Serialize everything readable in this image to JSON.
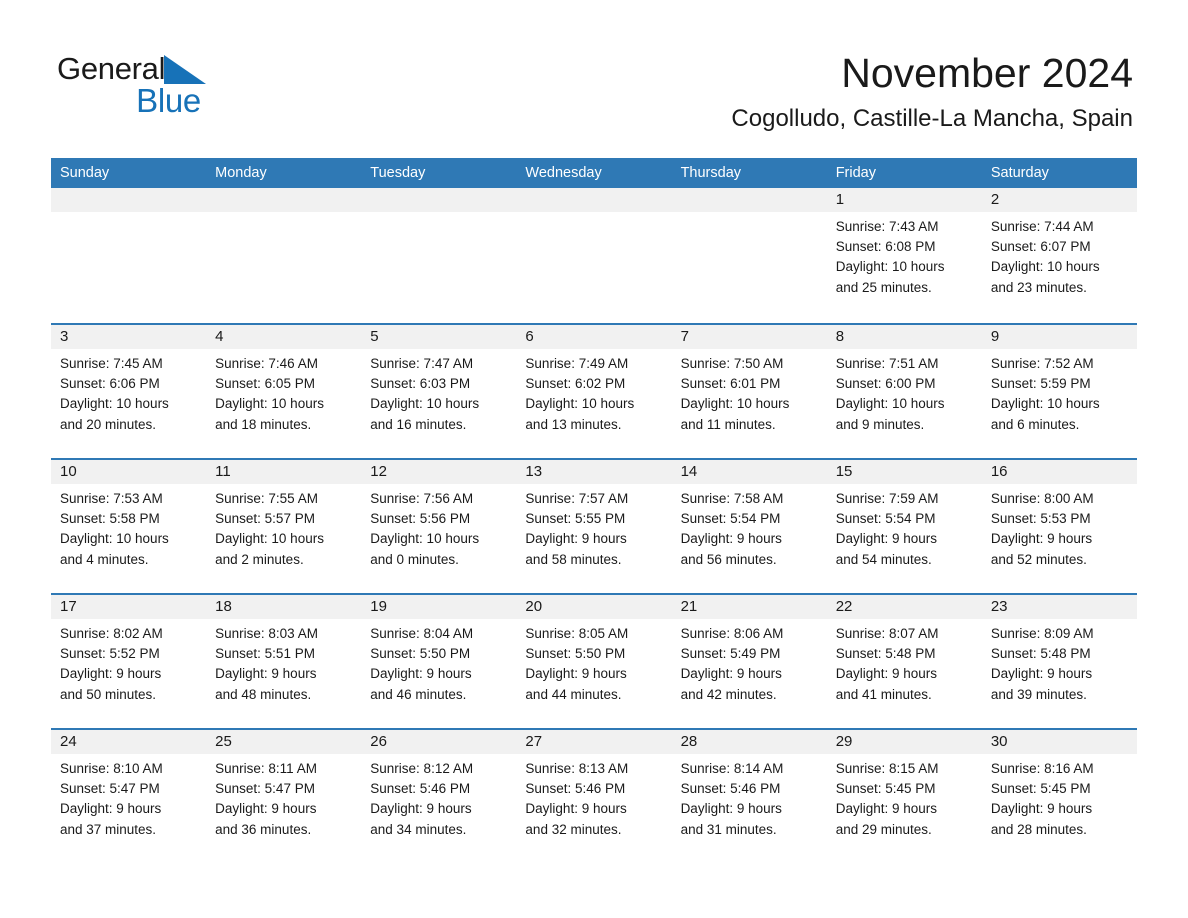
{
  "brand": {
    "name_part1": "General",
    "name_part2": "Blue",
    "accent_color": "#1772b8"
  },
  "header": {
    "month_title": "November 2024",
    "location": "Cogolludo, Castille-La Mancha, Spain"
  },
  "calendar": {
    "header_color": "#2f79b5",
    "weekdays": [
      "Sunday",
      "Monday",
      "Tuesday",
      "Wednesday",
      "Thursday",
      "Friday",
      "Saturday"
    ],
    "weeks": [
      [
        {
          "day": ""
        },
        {
          "day": ""
        },
        {
          "day": ""
        },
        {
          "day": ""
        },
        {
          "day": ""
        },
        {
          "day": "1",
          "sunrise": "Sunrise: 7:43 AM",
          "sunset": "Sunset: 6:08 PM",
          "daylight1": "Daylight: 10 hours",
          "daylight2": "and 25 minutes."
        },
        {
          "day": "2",
          "sunrise": "Sunrise: 7:44 AM",
          "sunset": "Sunset: 6:07 PM",
          "daylight1": "Daylight: 10 hours",
          "daylight2": "and 23 minutes."
        }
      ],
      [
        {
          "day": "3",
          "sunrise": "Sunrise: 7:45 AM",
          "sunset": "Sunset: 6:06 PM",
          "daylight1": "Daylight: 10 hours",
          "daylight2": "and 20 minutes."
        },
        {
          "day": "4",
          "sunrise": "Sunrise: 7:46 AM",
          "sunset": "Sunset: 6:05 PM",
          "daylight1": "Daylight: 10 hours",
          "daylight2": "and 18 minutes."
        },
        {
          "day": "5",
          "sunrise": "Sunrise: 7:47 AM",
          "sunset": "Sunset: 6:03 PM",
          "daylight1": "Daylight: 10 hours",
          "daylight2": "and 16 minutes."
        },
        {
          "day": "6",
          "sunrise": "Sunrise: 7:49 AM",
          "sunset": "Sunset: 6:02 PM",
          "daylight1": "Daylight: 10 hours",
          "daylight2": "and 13 minutes."
        },
        {
          "day": "7",
          "sunrise": "Sunrise: 7:50 AM",
          "sunset": "Sunset: 6:01 PM",
          "daylight1": "Daylight: 10 hours",
          "daylight2": "and 11 minutes."
        },
        {
          "day": "8",
          "sunrise": "Sunrise: 7:51 AM",
          "sunset": "Sunset: 6:00 PM",
          "daylight1": "Daylight: 10 hours",
          "daylight2": "and 9 minutes."
        },
        {
          "day": "9",
          "sunrise": "Sunrise: 7:52 AM",
          "sunset": "Sunset: 5:59 PM",
          "daylight1": "Daylight: 10 hours",
          "daylight2": "and 6 minutes."
        }
      ],
      [
        {
          "day": "10",
          "sunrise": "Sunrise: 7:53 AM",
          "sunset": "Sunset: 5:58 PM",
          "daylight1": "Daylight: 10 hours",
          "daylight2": "and 4 minutes."
        },
        {
          "day": "11",
          "sunrise": "Sunrise: 7:55 AM",
          "sunset": "Sunset: 5:57 PM",
          "daylight1": "Daylight: 10 hours",
          "daylight2": "and 2 minutes."
        },
        {
          "day": "12",
          "sunrise": "Sunrise: 7:56 AM",
          "sunset": "Sunset: 5:56 PM",
          "daylight1": "Daylight: 10 hours",
          "daylight2": "and 0 minutes."
        },
        {
          "day": "13",
          "sunrise": "Sunrise: 7:57 AM",
          "sunset": "Sunset: 5:55 PM",
          "daylight1": "Daylight: 9 hours",
          "daylight2": "and 58 minutes."
        },
        {
          "day": "14",
          "sunrise": "Sunrise: 7:58 AM",
          "sunset": "Sunset: 5:54 PM",
          "daylight1": "Daylight: 9 hours",
          "daylight2": "and 56 minutes."
        },
        {
          "day": "15",
          "sunrise": "Sunrise: 7:59 AM",
          "sunset": "Sunset: 5:54 PM",
          "daylight1": "Daylight: 9 hours",
          "daylight2": "and 54 minutes."
        },
        {
          "day": "16",
          "sunrise": "Sunrise: 8:00 AM",
          "sunset": "Sunset: 5:53 PM",
          "daylight1": "Daylight: 9 hours",
          "daylight2": "and 52 minutes."
        }
      ],
      [
        {
          "day": "17",
          "sunrise": "Sunrise: 8:02 AM",
          "sunset": "Sunset: 5:52 PM",
          "daylight1": "Daylight: 9 hours",
          "daylight2": "and 50 minutes."
        },
        {
          "day": "18",
          "sunrise": "Sunrise: 8:03 AM",
          "sunset": "Sunset: 5:51 PM",
          "daylight1": "Daylight: 9 hours",
          "daylight2": "and 48 minutes."
        },
        {
          "day": "19",
          "sunrise": "Sunrise: 8:04 AM",
          "sunset": "Sunset: 5:50 PM",
          "daylight1": "Daylight: 9 hours",
          "daylight2": "and 46 minutes."
        },
        {
          "day": "20",
          "sunrise": "Sunrise: 8:05 AM",
          "sunset": "Sunset: 5:50 PM",
          "daylight1": "Daylight: 9 hours",
          "daylight2": "and 44 minutes."
        },
        {
          "day": "21",
          "sunrise": "Sunrise: 8:06 AM",
          "sunset": "Sunset: 5:49 PM",
          "daylight1": "Daylight: 9 hours",
          "daylight2": "and 42 minutes."
        },
        {
          "day": "22",
          "sunrise": "Sunrise: 8:07 AM",
          "sunset": "Sunset: 5:48 PM",
          "daylight1": "Daylight: 9 hours",
          "daylight2": "and 41 minutes."
        },
        {
          "day": "23",
          "sunrise": "Sunrise: 8:09 AM",
          "sunset": "Sunset: 5:48 PM",
          "daylight1": "Daylight: 9 hours",
          "daylight2": "and 39 minutes."
        }
      ],
      [
        {
          "day": "24",
          "sunrise": "Sunrise: 8:10 AM",
          "sunset": "Sunset: 5:47 PM",
          "daylight1": "Daylight: 9 hours",
          "daylight2": "and 37 minutes."
        },
        {
          "day": "25",
          "sunrise": "Sunrise: 8:11 AM",
          "sunset": "Sunset: 5:47 PM",
          "daylight1": "Daylight: 9 hours",
          "daylight2": "and 36 minutes."
        },
        {
          "day": "26",
          "sunrise": "Sunrise: 8:12 AM",
          "sunset": "Sunset: 5:46 PM",
          "daylight1": "Daylight: 9 hours",
          "daylight2": "and 34 minutes."
        },
        {
          "day": "27",
          "sunrise": "Sunrise: 8:13 AM",
          "sunset": "Sunset: 5:46 PM",
          "daylight1": "Daylight: 9 hours",
          "daylight2": "and 32 minutes."
        },
        {
          "day": "28",
          "sunrise": "Sunrise: 8:14 AM",
          "sunset": "Sunset: 5:46 PM",
          "daylight1": "Daylight: 9 hours",
          "daylight2": "and 31 minutes."
        },
        {
          "day": "29",
          "sunrise": "Sunrise: 8:15 AM",
          "sunset": "Sunset: 5:45 PM",
          "daylight1": "Daylight: 9 hours",
          "daylight2": "and 29 minutes."
        },
        {
          "day": "30",
          "sunrise": "Sunrise: 8:16 AM",
          "sunset": "Sunset: 5:45 PM",
          "daylight1": "Daylight: 9 hours",
          "daylight2": "and 28 minutes."
        }
      ]
    ]
  }
}
